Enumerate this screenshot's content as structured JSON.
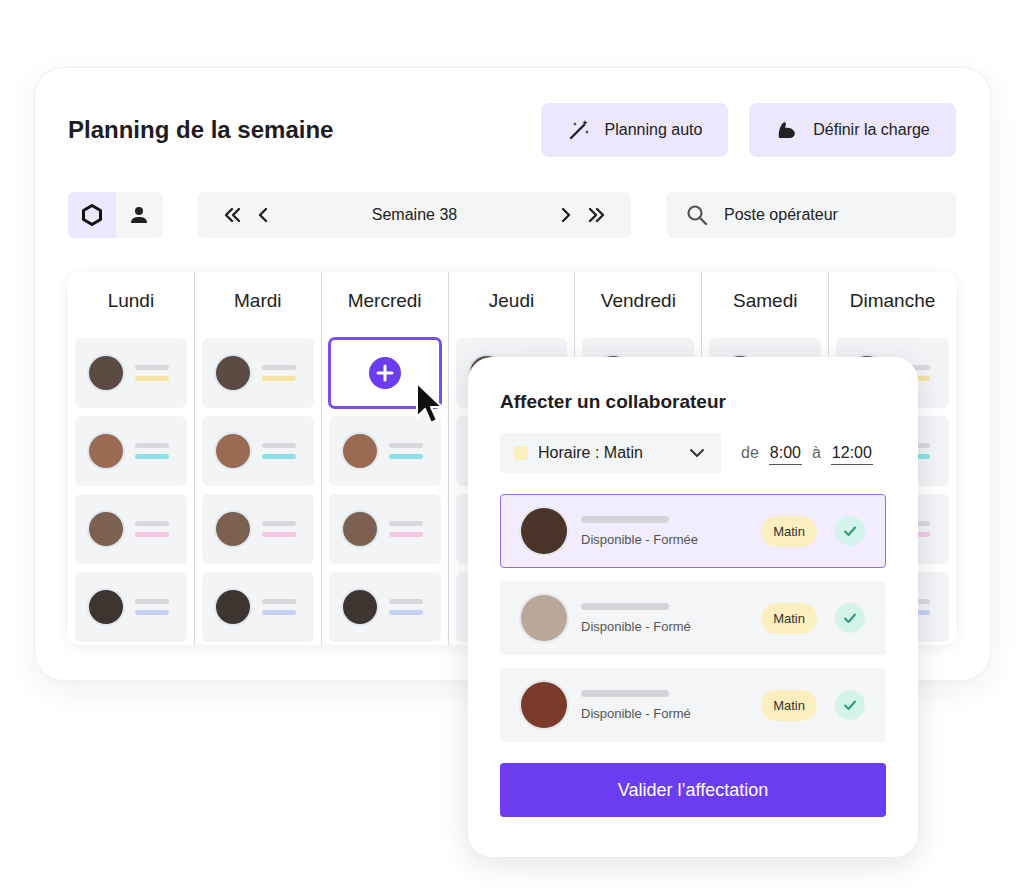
{
  "title": "Planning de la semaine",
  "actions": [
    {
      "label": "Planning auto"
    },
    {
      "label": "Définir la charge"
    }
  ],
  "view_toggle": [
    {
      "selected": true
    },
    {
      "selected": false
    }
  ],
  "week_nav": {
    "label": "Semaine 38"
  },
  "search": {
    "placeholder": "Poste opérateur"
  },
  "days": [
    {
      "label": "Lundi",
      "cells": [
        {
          "kind": "assigned",
          "color": "#f6e3a1",
          "selected": false
        },
        {
          "kind": "assigned",
          "color": "#8ee0e8",
          "selected": false
        },
        {
          "kind": "assigned",
          "color": "#f6c6e4",
          "selected": false
        },
        {
          "kind": "assigned",
          "color": "#c4d0f7",
          "selected": false
        }
      ]
    },
    {
      "label": "Mardi",
      "cells": [
        {
          "kind": "assigned",
          "color": "#f6e3a1",
          "selected": false
        },
        {
          "kind": "assigned",
          "color": "#8ee0e8",
          "selected": false
        },
        {
          "kind": "assigned",
          "color": "#f6c6e4",
          "selected": false
        },
        {
          "kind": "assigned",
          "color": "#c4d0f7",
          "selected": false
        }
      ]
    },
    {
      "label": "Mercredi",
      "cells": [
        {
          "kind": "add",
          "selected": true
        },
        {
          "kind": "assigned",
          "color": "#8ee0e8",
          "selected": false
        },
        {
          "kind": "assigned",
          "color": "#f6c6e4",
          "selected": false
        },
        {
          "kind": "assigned",
          "color": "#c4d0f7",
          "selected": false
        }
      ]
    },
    {
      "label": "Jeudi",
      "cells": [
        {
          "kind": "assigned",
          "color": "#f6e3a1",
          "selected": false
        },
        {
          "kind": "assigned",
          "color": "#8ee0e8",
          "selected": false
        },
        {
          "kind": "assigned",
          "color": "#f6c6e4",
          "selected": false
        },
        {
          "kind": "assigned",
          "color": "#c4d0f7",
          "selected": false
        }
      ]
    },
    {
      "label": "Vendredi",
      "cells": [
        {
          "kind": "assigned",
          "color": "#f6e3a1",
          "selected": false
        },
        {
          "kind": "assigned",
          "color": "#8ee0e8",
          "selected": false
        },
        {
          "kind": "assigned",
          "color": "#f6c6e4",
          "selected": false
        },
        {
          "kind": "assigned",
          "color": "#c4d0f7",
          "selected": false
        }
      ]
    },
    {
      "label": "Samedi",
      "cells": [
        {
          "kind": "assigned",
          "color": "#f6e3a1",
          "selected": false
        },
        {
          "kind": "assigned",
          "color": "#8ee0e8",
          "selected": false
        },
        {
          "kind": "assigned",
          "color": "#f6c6e4",
          "selected": false
        },
        {
          "kind": "assigned",
          "color": "#c4d0f7",
          "selected": false
        }
      ]
    },
    {
      "label": "Dimanche",
      "cells": [
        {
          "kind": "assigned",
          "color": "#f6e3a1",
          "selected": false
        },
        {
          "kind": "assigned",
          "color": "#8ee0e8",
          "selected": false
        },
        {
          "kind": "assigned",
          "color": "#f6c6e4",
          "selected": false
        },
        {
          "kind": "assigned",
          "color": "#c4d0f7",
          "selected": false
        }
      ]
    }
  ],
  "popup": {
    "title": "Affecter un collaborateur",
    "shift": {
      "label": "Horaire : Matin",
      "color": "#fcefbf"
    },
    "from_label": "de",
    "from": "8:00",
    "to_label": "à",
    "to": "12:00",
    "candidates": [
      {
        "status": "Disponible - Formée",
        "tag": "Matin",
        "selected": true,
        "checked": true
      },
      {
        "status": "Disponible - Formé",
        "tag": "Matin",
        "selected": false,
        "checked": true
      },
      {
        "status": "Disponible - Formé",
        "tag": "Matin",
        "selected": false,
        "checked": true
      }
    ],
    "confirm": "Valider l’affectation"
  }
}
